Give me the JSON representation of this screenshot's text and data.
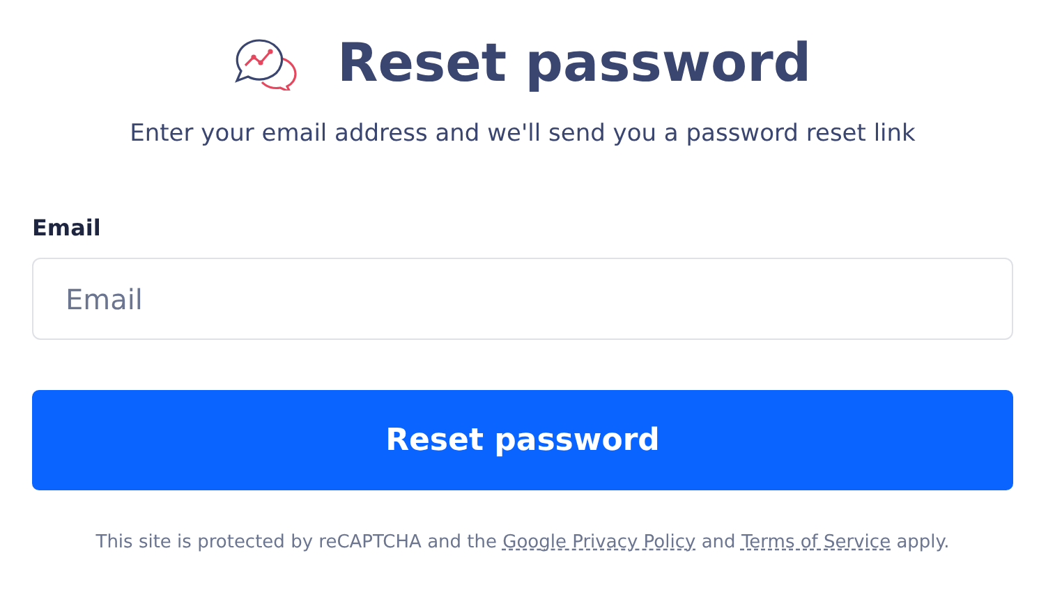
{
  "header": {
    "title": "Reset password",
    "subtitle": "Enter your email address and we'll send you a password reset link"
  },
  "form": {
    "label": "Email",
    "placeholder": "Email",
    "button": "Reset password"
  },
  "notice": [
    {
      "kind": "text",
      "text": "This site is protected by reCAPTCHA and the "
    },
    {
      "kind": "link",
      "text": "Google Privacy Policy"
    },
    {
      "kind": "text",
      "text": " and "
    },
    {
      "kind": "link",
      "text": "Terms of Service"
    },
    {
      "kind": "text",
      "text": " apply."
    }
  ]
}
